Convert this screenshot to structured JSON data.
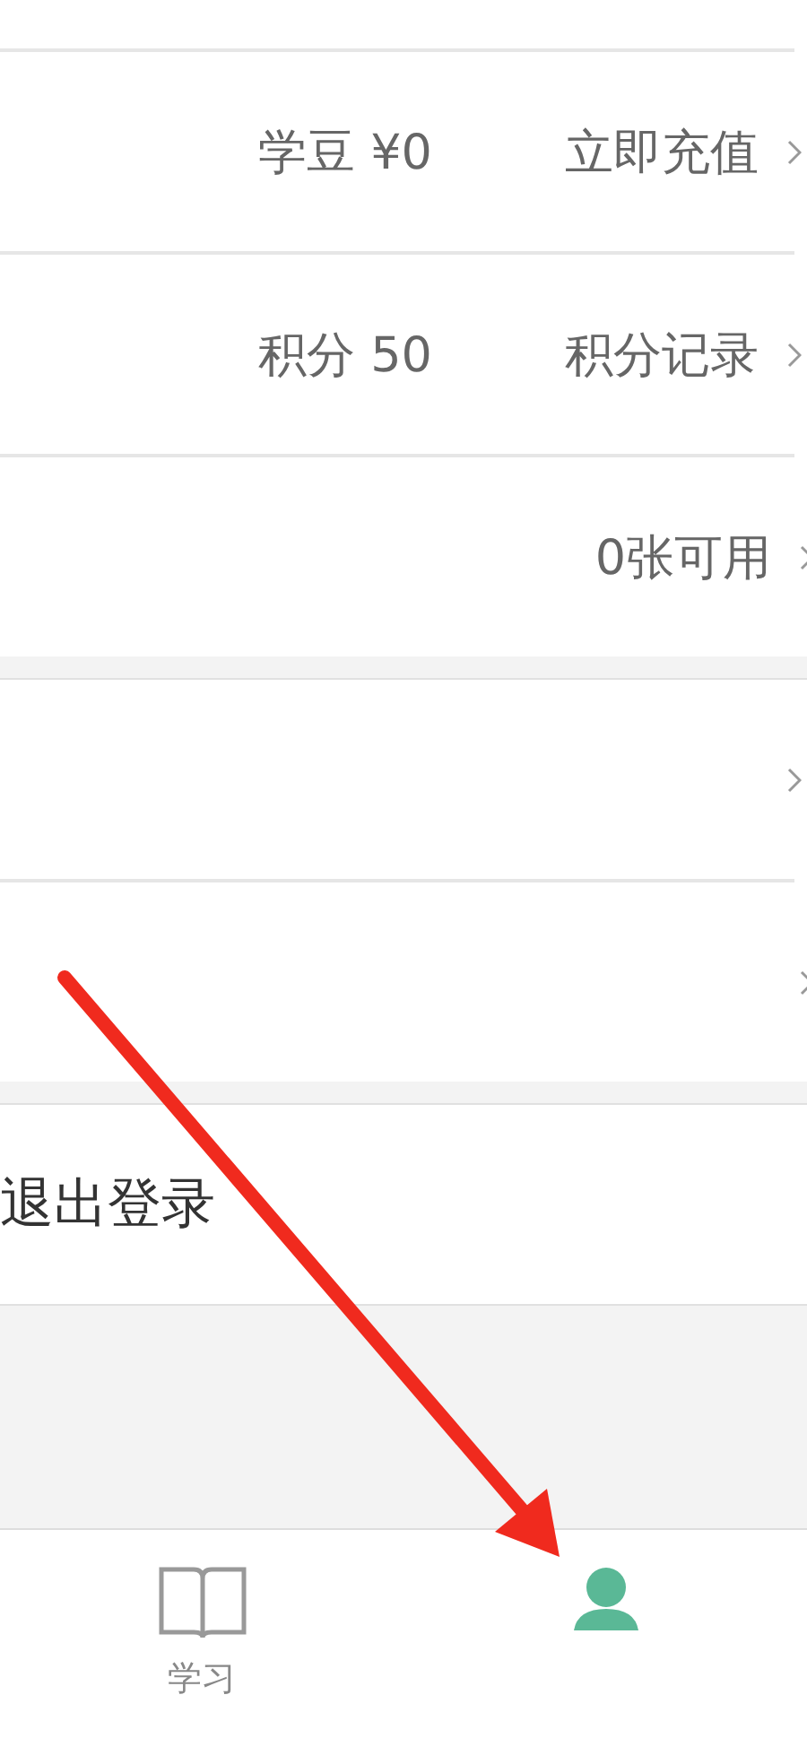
{
  "sections": [
    {
      "rows": [
        {
          "value": "学豆 ¥0",
          "action": "立即充值",
          "chevron": true
        },
        {
          "value": "积分 50",
          "action": "积分记录",
          "chevron": true
        },
        {
          "action": "0张可用",
          "chevron": true
        }
      ]
    },
    {
      "rows": [
        {
          "chevron": true
        },
        {
          "chevron": true
        }
      ]
    },
    {
      "rows": [
        {
          "label": "退出登录",
          "chevron": false
        }
      ]
    }
  ],
  "annotation": {
    "kind": "arrow"
  },
  "tab_bar": [
    {
      "kind": "book",
      "label": "学习",
      "selected": false
    },
    {
      "kind": "person",
      "selected": true
    }
  ]
}
